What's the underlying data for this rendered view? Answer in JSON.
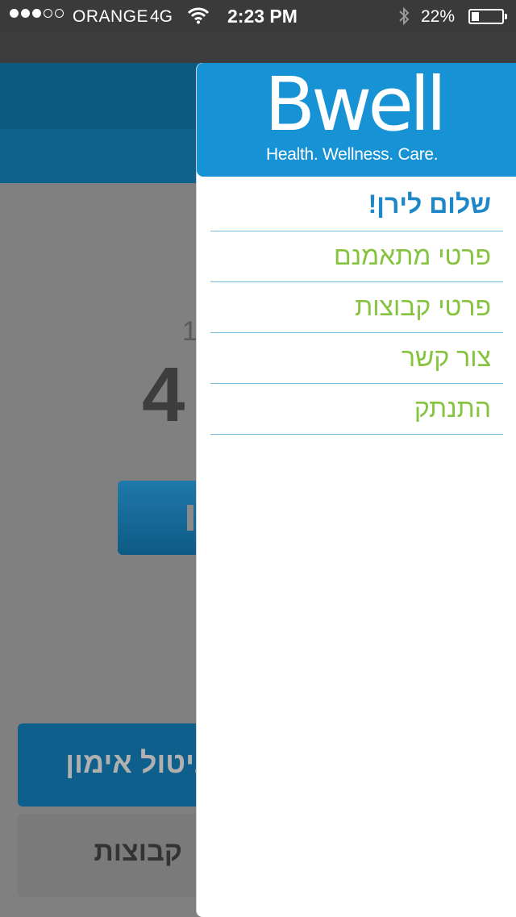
{
  "status_bar": {
    "signal_dots_filled": 3,
    "signal_dots_total": 5,
    "carrier": "ORANGE",
    "network": "4G",
    "time": "2:23 PM",
    "battery_percent": "22%",
    "icons": [
      "wifi-icon",
      "bluetooth-icon",
      "battery-icon"
    ]
  },
  "background_screen": {
    "small_number": "1",
    "big_number": "4",
    "cancel_training_label": "ביטול אימון",
    "groups_label": "קבוצות"
  },
  "menu": {
    "logo_text": "Bwell",
    "logo_tagline": "Health. Wellness. Care.",
    "greeting": "שלום לירן!",
    "items": [
      {
        "label": "פרטי מתאמנם"
      },
      {
        "label": "פרטי קבוצות"
      },
      {
        "label": "צור קשר"
      },
      {
        "label": "התנתק"
      }
    ]
  },
  "colors": {
    "brand_blue": "#1792d4",
    "greeting_blue": "#1e87c8",
    "item_green": "#86c440",
    "divider": "#7cbde3"
  }
}
